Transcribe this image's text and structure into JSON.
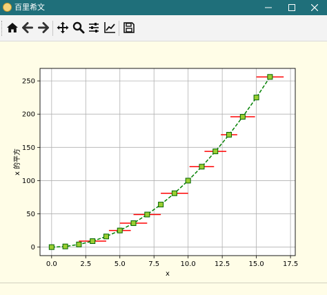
{
  "window": {
    "title": "百里希文",
    "minimize_icon": "minimize-icon",
    "maximize_icon": "maximize-icon",
    "close_icon": "close-icon"
  },
  "toolbar": {
    "buttons": [
      {
        "name": "home-button",
        "icon": "home-icon"
      },
      {
        "name": "back-button",
        "icon": "arrow-left-icon"
      },
      {
        "name": "forward-button",
        "icon": "arrow-right-icon"
      },
      {
        "name": "pan-button",
        "icon": "move-icon"
      },
      {
        "name": "zoom-button",
        "icon": "zoom-icon"
      },
      {
        "name": "subplots-button",
        "icon": "sliders-icon"
      },
      {
        "name": "axes-button",
        "icon": "line-chart-icon"
      },
      {
        "name": "save-button",
        "icon": "save-icon"
      }
    ]
  },
  "chart_data": {
    "type": "line",
    "title": "",
    "xlabel": "x",
    "ylabel": "x 的平方",
    "xlim": [
      -0.85,
      17.85
    ],
    "ylim": [
      -12.8,
      268.8
    ],
    "xticks": [
      "0.0",
      "2.5",
      "5.0",
      "7.5",
      "10.0",
      "12.5",
      "15.0",
      "17.5"
    ],
    "xtick_values": [
      0,
      2.5,
      5,
      7.5,
      10,
      12.5,
      15,
      17.5
    ],
    "yticks": [
      "0",
      "50",
      "100",
      "150",
      "200",
      "250"
    ],
    "ytick_values": [
      0,
      50,
      100,
      150,
      200,
      250
    ],
    "grid": true,
    "x": [
      0,
      1,
      2,
      3,
      4,
      5,
      6,
      7,
      8,
      9,
      10,
      11,
      12,
      13,
      14,
      15,
      16
    ],
    "y": [
      0,
      1,
      4,
      9,
      16,
      25,
      36,
      49,
      64,
      81,
      100,
      121,
      144,
      169,
      196,
      225,
      256
    ],
    "xerr": [
      0,
      0,
      0,
      1,
      0,
      0.8,
      1,
      1,
      0,
      1,
      0,
      0.9,
      0.8,
      0.6,
      0.9,
      0,
      1
    ],
    "colors": {
      "line": "#008000",
      "marker_face": "#9acd32",
      "marker_edge": "#006400",
      "errorbar": "#ff0000",
      "grid": "#b0b0b0",
      "axes_face": "#ffffff",
      "figure_face": "#fffde7"
    }
  }
}
